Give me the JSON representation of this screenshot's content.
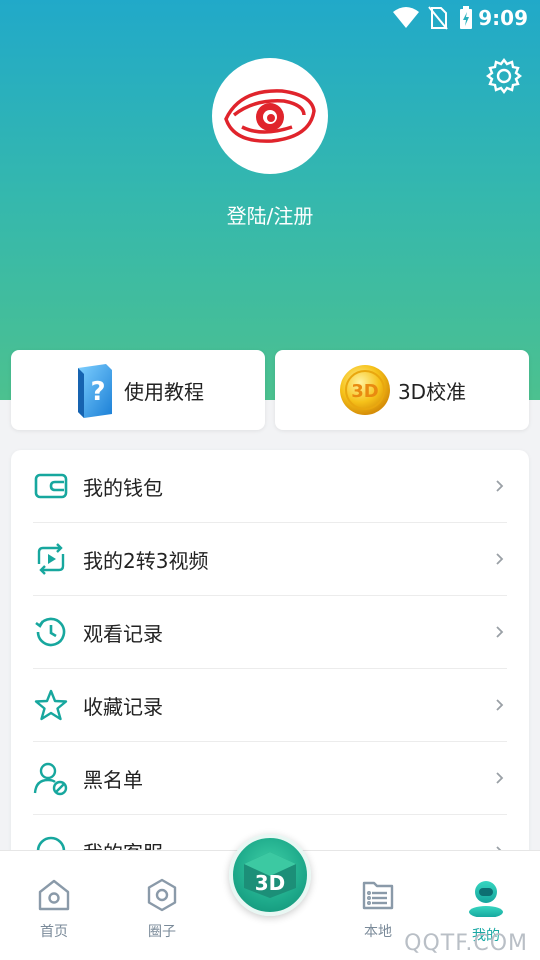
{
  "status_bar": {
    "time": "9:09",
    "icons": [
      "wifi-icon",
      "no-sim-icon",
      "battery-charging-icon"
    ]
  },
  "header": {
    "settings_icon": "gear-icon",
    "login_text": "登陆/注册"
  },
  "quick_actions": [
    {
      "label": "使用教程",
      "icon": "tutorial-book-icon"
    },
    {
      "label": "3D校准",
      "icon": "3d-coin-icon"
    }
  ],
  "menu": {
    "items": [
      {
        "label": "我的钱包",
        "icon": "wallet-icon"
      },
      {
        "label": "我的2转3视频",
        "icon": "convert-video-icon"
      },
      {
        "label": "观看记录",
        "icon": "history-icon"
      },
      {
        "label": "收藏记录",
        "icon": "star-icon"
      },
      {
        "label": "黑名单",
        "icon": "blocked-user-icon"
      },
      {
        "label": "我的客服",
        "icon": "headset-icon"
      }
    ]
  },
  "bottom_nav": {
    "tabs": [
      {
        "label": "首页",
        "icon": "home-icon",
        "active": false
      },
      {
        "label": "圈子",
        "icon": "hexagon-icon",
        "active": false
      },
      {
        "label": "本地",
        "icon": "folder-list-icon",
        "active": false
      },
      {
        "label": "我的",
        "icon": "profile-icon",
        "active": true
      }
    ],
    "center": "3D"
  },
  "watermark": "QQTF.COM",
  "colors": {
    "accent": "#1aa8a4",
    "header_top": "#21a9c9",
    "header_bottom": "#4cc18f",
    "icon_teal": "#17a79e"
  }
}
